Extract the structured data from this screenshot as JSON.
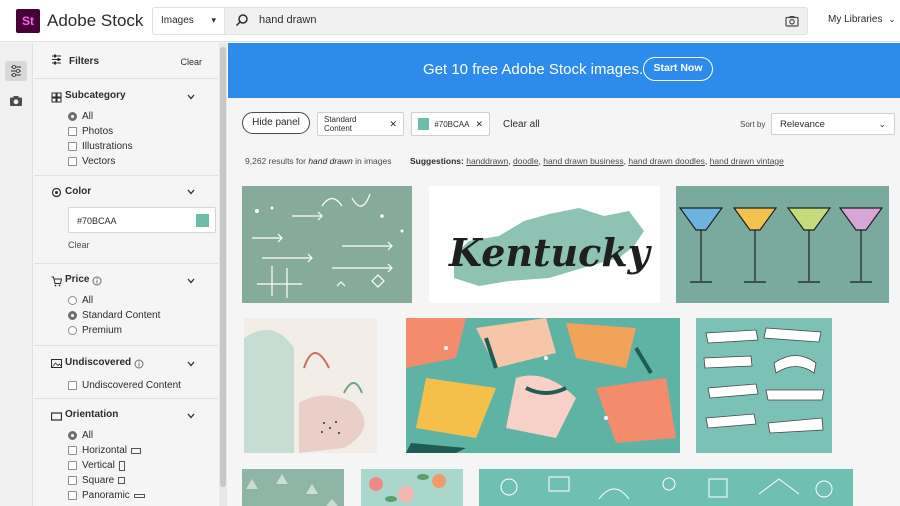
{
  "header": {
    "logo_text": "St",
    "brand": "Adobe Stock",
    "search_type": "Images",
    "search_query": "hand drawn",
    "my_libraries": "My Libraries"
  },
  "filters": {
    "title": "Filters",
    "clear": "Clear",
    "subcategory": {
      "title": "Subcategory",
      "options": [
        "All",
        "Photos",
        "Illustrations",
        "Vectors"
      ],
      "selected": "All"
    },
    "color": {
      "title": "Color",
      "value": "#70BCAA",
      "clear": "Clear"
    },
    "price": {
      "title": "Price",
      "options": [
        "All",
        "Standard Content",
        "Premium"
      ],
      "selected": "Standard Content"
    },
    "undiscovered": {
      "title": "Undiscovered",
      "option": "Undiscovered Content"
    },
    "orientation": {
      "title": "Orientation",
      "options": [
        "All",
        "Horizontal",
        "Vertical",
        "Square",
        "Panoramic"
      ],
      "selected": "All"
    }
  },
  "banner": {
    "message": "Get 10 free Adobe Stock images.",
    "button": "Start Now"
  },
  "toolbar": {
    "hide_panel": "Hide panel",
    "chip_content": "Standard Content",
    "chip_color": "#70BCAA",
    "clear_all": "Clear all",
    "sort_label": "Sort by",
    "sort_value": "Relevance"
  },
  "results": {
    "count": "9,262",
    "text_before": " results for ",
    "query": "hand drawn",
    "text_after": " in images"
  },
  "suggestions": {
    "label": "Suggestions:",
    "items": [
      "handdrawn",
      "doodle",
      "hand drawn business",
      "hand drawn doodles",
      "hand drawn vintage"
    ]
  },
  "images": {
    "kentucky_text": "Kentucky"
  },
  "colors": {
    "accent": "#2d8ceb",
    "swatch": "#70BCAA"
  }
}
